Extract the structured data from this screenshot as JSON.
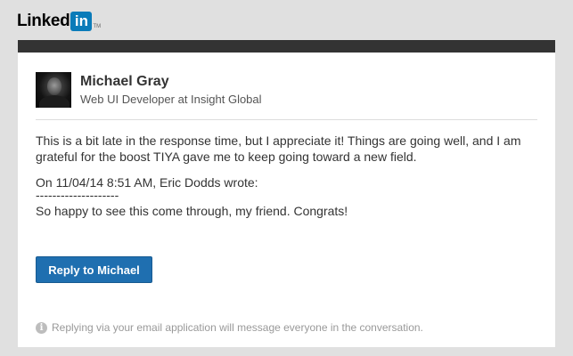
{
  "brand": {
    "logo_text": "Linked",
    "logo_box": "in",
    "logo_tm": "TM",
    "logo_color": "#0a7bb9"
  },
  "message": {
    "sender_name": "Michael Gray",
    "sender_title": "Web UI Developer at Insight Global",
    "body": "This is a bit late in the response time, but I appreciate it! Things are going well, and I am grateful for the boost TIYA gave me to keep going toward a new field.",
    "quote_header": "On 11/04/14 8:51 AM, Eric Dodds wrote:",
    "quote_separator": "--------------------",
    "quote_body": "So happy to see this come through, my friend. Congrats!"
  },
  "actions": {
    "reply_label": "Reply to Michael",
    "reply_color": "#1f6fb0"
  },
  "footer": {
    "notice_icon": "info-icon",
    "notice_text": "Replying via your email application will message everyone in the conversation."
  }
}
